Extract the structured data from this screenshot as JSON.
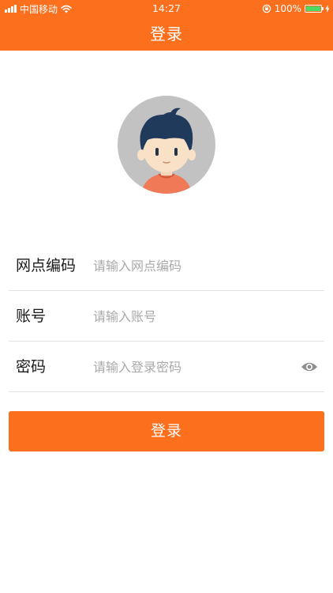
{
  "status_bar": {
    "carrier": "中国移动",
    "time": "14:27",
    "battery": "100%",
    "signal_icon": "signal-bars-icon",
    "wifi_icon": "wifi-icon",
    "orientation_icon": "orientation-lock-icon",
    "battery_icon": "battery-icon",
    "charging_icon": "charging-bolt-icon"
  },
  "header": {
    "title": "登录"
  },
  "avatar": {
    "icon": "cartoon-boy-avatar"
  },
  "form": {
    "branch_code": {
      "label": "网点编码",
      "placeholder": "请输入网点编码",
      "value": ""
    },
    "account": {
      "label": "账号",
      "placeholder": "请输入账号",
      "value": ""
    },
    "password": {
      "label": "密码",
      "placeholder": "请输入登录密码",
      "value": "",
      "toggle_icon": "eye-icon"
    }
  },
  "login_button": {
    "label": "登录"
  },
  "colors": {
    "accent": "#fb6f1d",
    "divider": "#e2e2e2",
    "placeholder": "#a9a9a9",
    "avatar_background": "#c2c2c2",
    "battery_fill": "#4cd964"
  }
}
